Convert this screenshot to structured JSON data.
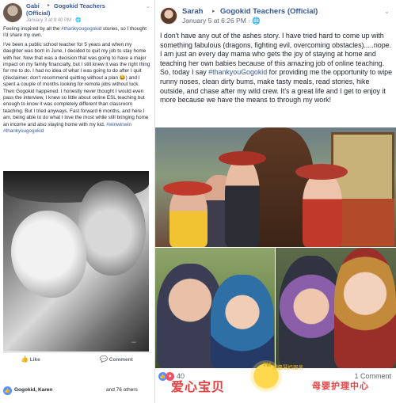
{
  "left_post": {
    "author": "Gabi",
    "author_suffix": "(Official)",
    "arrow": "▸",
    "group": "Gogokid Teachers",
    "timestamp": "January 3 at 9:40 PM · 🌐",
    "paragraph1_prefix": "Feeling inspired by all the ",
    "paragraph1_hashtag": "#thankyougogokid",
    "paragraph1_suffix": " stories, so I thought I'd share my own.",
    "paragraph2_main": "I've been a public school teacher for 5 years and when my daughter was born in June, I decided to quit my job to stay home with her. Now that was a decision that was going to have a major impact on my family financially, but I still knew it was the right thing for me to do. I had no idea of what I was going to do after I quit (disclaimer: don't recommend quitting without a plan 😂) and I spent a couple of months looking for remote jobs without luck. Then Gogokid happened. I honestly never thought I would even pass the interview, I knew so little about online ESL teaching but enough to know it was completely different than classroom teaching. But I tried anyways. Fast forward 6 months, and here I am, being able to do what I love the most while still bringing home an income and also staying home with my kid. ",
    "paragraph2_hashtag": "#winwinwin",
    "paragraph2_hashtag2": "#thankyougogokid",
    "more_label": "•••",
    "like_label": "Like",
    "comment_label": "Comment",
    "reaction_names": "Gogokid, Karen",
    "reaction_others": "and 76 others"
  },
  "right_post": {
    "author": "Sarah",
    "arrow": "▸",
    "group": "Gogokid Teachers (Official)",
    "timestamp": "January 5 at 6:26 PM · 🌐",
    "body_main": "I don't have any out of the ashes story. I have tried hard to come up with something fabulous (dragons, fighting evil, overcoming obstacles).....nope. I am just an every day mama who gets the joy of staying at home and teaching her own babies because of this amazing job of online teaching. So, today I say ",
    "body_hashtag": "#thankyouGogokid",
    "body_rest": " for providing me the opportunity to wipe runny noses, clean dirty bums, make tasty meals, read stories, hike outside, and chase after my wild crew. It's a great life and I get to enjoy it more because we have the means to through my work!",
    "reaction_count": "40",
    "comment_count": "1 Comment"
  },
  "watermark": {
    "tm": "TM",
    "small_text": "高晨慧妈服务",
    "brand_cn": "爱心宝贝",
    "tagline_cn": "母婴护理中心"
  },
  "icons": {
    "chevron": "⌄",
    "thumb": "👍",
    "comment": "💬",
    "heart": "♥"
  }
}
